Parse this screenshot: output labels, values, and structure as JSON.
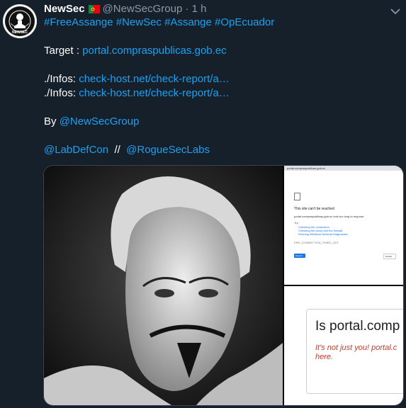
{
  "tweet": {
    "author_name": "NewSec",
    "handle": "@NewSecGroup",
    "separator": "·",
    "time": "1 h",
    "hashtags": "#FreeAssange #NewSec #Assange #OpEcuador",
    "target_label": "Target : ",
    "target_link": "portal.compraspublicas.gob.ec",
    "infos_label_1": "./Infos: ",
    "infos_link_1": "check-host.net/check-report/a…",
    "infos_label_2": "./Infos: ",
    "infos_link_2": "check-host.net/check-report/a…",
    "by_label": "By ",
    "by_link": "@NewSecGroup",
    "mention_1": "@LabDefCon",
    "mention_sep": "//",
    "mention_2": "@RogueSecLabs"
  },
  "avatar": {
    "logo_text": "NEWSEC"
  },
  "media": {
    "screenshot_top": {
      "tab_text": "portal.compraspublicas.gob.ec",
      "heading": "This site can't be reached",
      "subtext": "portal.compraspublicas.gob.ec took too long to respond.",
      "try_label": "Try:",
      "suggestions": [
        "Checking the connection",
        "Checking the proxy and the firewall",
        "Running Windows Network Diagnostics"
      ],
      "error_code": "ERR_CONNECTION_TIMED_OUT",
      "reload_label": "Reload",
      "details_label": "Details"
    },
    "screenshot_bottom": {
      "title": "Is portal.comp",
      "error_line_1": "It's not just you! portal.c",
      "error_line_2": "here."
    }
  },
  "colors": {
    "background": "#15202b",
    "link": "#1da1f2",
    "muted": "#8899a6"
  }
}
